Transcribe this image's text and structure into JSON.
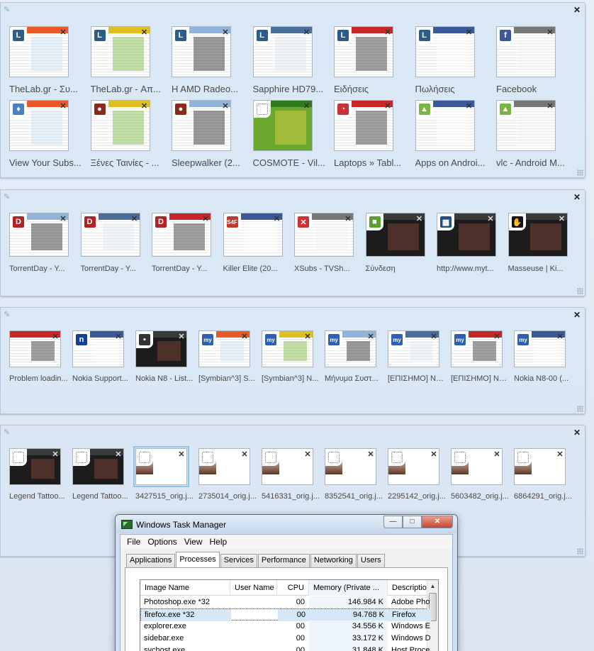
{
  "groups": [
    {
      "tabs": [
        {
          "title": "TheLab.gr - Συ...",
          "icon": "thelab-icon",
          "glyph": "L",
          "color": "#2e5c8a"
        },
        {
          "title": "TheLab.gr - Απ...",
          "icon": "thelab-icon",
          "glyph": "L",
          "color": "#2e5c8a"
        },
        {
          "title": "H AMD Radeo...",
          "icon": "thelab-icon",
          "glyph": "L",
          "color": "#2e5c8a"
        },
        {
          "title": "Sapphire HD79...",
          "icon": "thelab-icon",
          "glyph": "L",
          "color": "#2e5c8a"
        },
        {
          "title": "Ειδήσεις",
          "icon": "thelab-icon",
          "glyph": "L",
          "color": "#2e5c8a"
        },
        {
          "title": "Πωλήσεις",
          "icon": "thelab-icon",
          "glyph": "L",
          "color": "#2e5c8a"
        },
        {
          "title": "Facebook",
          "icon": "facebook-icon",
          "glyph": "f",
          "color": "#3b5998"
        },
        {
          "title": "View Your Subs...",
          "icon": "flame-icon",
          "glyph": "♦",
          "color": "#4a7fc1"
        },
        {
          "title": "Ξένες Ταινίες - ...",
          "icon": "helmet-icon",
          "glyph": "●",
          "color": "#8a2a1a"
        },
        {
          "title": "Sleepwalker (2...",
          "icon": "helmet-icon",
          "glyph": "●",
          "color": "#8a2a1a"
        },
        {
          "title": "COSMOTE - Vil...",
          "icon": "blank-page-icon",
          "glyph": "",
          "color": "#ffffff"
        },
        {
          "title": "Laptops » Tabl...",
          "icon": "gauge-icon",
          "glyph": "◔",
          "color": "#c93232"
        },
        {
          "title": "Apps on Androi...",
          "icon": "android-icon",
          "glyph": "▲",
          "color": "#7cb342"
        },
        {
          "title": "vlc - Android M...",
          "icon": "android-icon",
          "glyph": "▲",
          "color": "#7cb342"
        }
      ]
    },
    {
      "tabs": [
        {
          "title": "TorrentDay - Y...",
          "icon": "torrentday-icon",
          "glyph": "D",
          "color": "#b22222"
        },
        {
          "title": "TorrentDay - Y...",
          "icon": "torrentday-icon",
          "glyph": "D",
          "color": "#b22222"
        },
        {
          "title": "TorrentDay - Y...",
          "icon": "torrentday-icon",
          "glyph": "D",
          "color": "#b22222"
        },
        {
          "title": "Killer Elite (20...",
          "icon": "s4f-icon",
          "glyph": "S4F",
          "color": "#c0392b"
        },
        {
          "title": "XSubs - TVSh...",
          "icon": "xsubs-icon",
          "glyph": "✕",
          "color": "#d32f2f"
        },
        {
          "title": "Σύνδεση",
          "icon": "chat-bubble-icon",
          "glyph": "■",
          "color": "#5aa02c"
        },
        {
          "title": "http://www.myt...",
          "icon": "film-icon",
          "glyph": "▦",
          "color": "#1f4e8c"
        },
        {
          "title": "Masseuse | Ki...",
          "icon": "hand-icon",
          "glyph": "✋",
          "color": "#111111"
        }
      ]
    },
    {
      "tabs": [
        {
          "title": "Problem loadin...",
          "icon": "none",
          "glyph": "",
          "color": "#ffffff"
        },
        {
          "title": "Nokia Support...",
          "icon": "nokia-icon",
          "glyph": "n",
          "color": "#124191"
        },
        {
          "title": "Nokia N8 - List...",
          "icon": "nokia-n8-icon",
          "glyph": "▪",
          "color": "#333333"
        },
        {
          "title": "[Symbian^3] S...",
          "icon": "mysymbian-icon",
          "glyph": "my",
          "color": "#2f5fb3"
        },
        {
          "title": "[Symbian^3] N...",
          "icon": "mysymbian-icon",
          "glyph": "my",
          "color": "#2f5fb3"
        },
        {
          "title": "Μήνυμα Συστ...",
          "icon": "mysymbian-icon",
          "glyph": "my",
          "color": "#2f5fb3"
        },
        {
          "title": "[ΕΠΙΣΗΜΟ] No...",
          "icon": "mysymbian-icon",
          "glyph": "my",
          "color": "#2f5fb3"
        },
        {
          "title": "[ΕΠΙΣΗΜΟ] No...",
          "icon": "mysymbian-icon",
          "glyph": "my",
          "color": "#2f5fb3"
        },
        {
          "title": "Nokia N8-00 (...",
          "icon": "mysymbian-icon",
          "glyph": "my",
          "color": "#2f5fb3"
        }
      ]
    },
    {
      "tabs": [
        {
          "title": "Legend Tattoo...",
          "icon": "blank-page-icon",
          "glyph": "",
          "color": "#ffffff"
        },
        {
          "title": "Legend Tattoo...",
          "icon": "blank-page-icon",
          "glyph": "",
          "color": "#ffffff"
        },
        {
          "title": "3427515_orig.j...",
          "icon": "image-icon",
          "glyph": "",
          "color": "#ffffff"
        },
        {
          "title": "2735014_orig.j...",
          "icon": "image-icon",
          "glyph": "",
          "color": "#ffffff"
        },
        {
          "title": "5416331_orig.j...",
          "icon": "image-icon",
          "glyph": "",
          "color": "#ffffff"
        },
        {
          "title": "8352541_orig.j...",
          "icon": "image-icon",
          "glyph": "",
          "color": "#ffffff"
        },
        {
          "title": "2295142_orig.j...",
          "icon": "image-icon",
          "glyph": "",
          "color": "#ffffff"
        },
        {
          "title": "5603482_orig.j...",
          "icon": "image-icon",
          "glyph": "",
          "color": "#ffffff"
        },
        {
          "title": "6864291_orig.j...",
          "icon": "image-icon",
          "glyph": "",
          "color": "#ffffff"
        }
      ]
    }
  ],
  "task_manager": {
    "title": "Windows Task Manager",
    "window_controls": {
      "minimize": "—",
      "maximize": "□",
      "close": "✕"
    },
    "menu": [
      "File",
      "Options",
      "View",
      "Help"
    ],
    "tabs": [
      "Applications",
      "Processes",
      "Services",
      "Performance",
      "Networking",
      "Users"
    ],
    "active_tab": "Processes",
    "columns": [
      "Image Name",
      "User Name",
      "CPU",
      "Memory (Private ...",
      "Description"
    ],
    "rows": [
      {
        "image": "Photoshop.exe *32",
        "user": "",
        "cpu": "00",
        "memory": "146.984 K",
        "description": "Adobe Photoshop"
      },
      {
        "image": "firefox.exe *32",
        "user": "",
        "cpu": "00",
        "memory": "94.768 K",
        "description": "Firefox"
      },
      {
        "image": "explorer.exe",
        "user": "",
        "cpu": "00",
        "memory": "34.556 K",
        "description": "Windows Explorer"
      },
      {
        "image": "sidebar.exe",
        "user": "",
        "cpu": "00",
        "memory": "33.172 K",
        "description": "Windows Desktop Gadgets"
      },
      {
        "image": "svchost.exe",
        "user": "",
        "cpu": "00",
        "memory": "31.848 K",
        "description": "Host Process"
      }
    ],
    "selected_row": 1
  }
}
